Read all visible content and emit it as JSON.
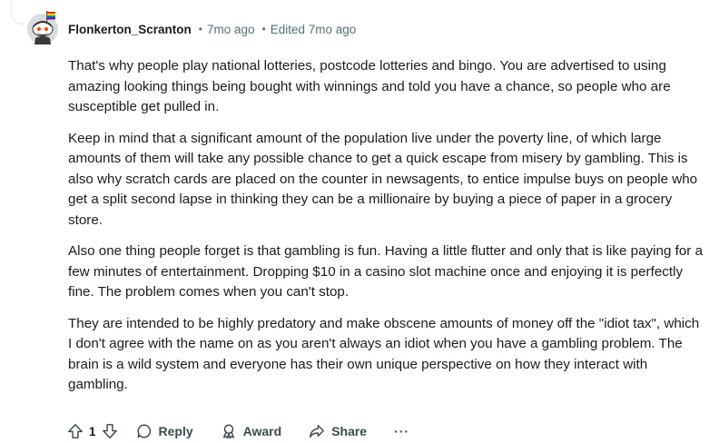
{
  "comment": {
    "username": "Flonkerton_Scranton",
    "separator": "•",
    "time": "7mo ago",
    "edited": "Edited 7mo ago",
    "paragraphs": [
      "That's why people play national lotteries, postcode lotteries and bingo. You are advertised to using amazing looking things being bought with winnings and told you have a chance, so people who are susceptible get pulled in.",
      "Keep in mind that a significant amount of the population live under the poverty line, of which large amounts of them will take any possible chance to get a quick escape from misery by gambling. This is also why scratch cards are placed on the counter in newsagents, to entice impulse buys on people who get a split second lapse in thinking they can be a millionaire by buying a piece of paper in a grocery store.",
      "Also one thing people forget is that gambling is fun. Having a little flutter and only that is like paying for a few minutes of entertainment. Dropping $10 in a casino slot machine once and enjoying it is perfectly fine. The problem comes when you can't stop.",
      "They are intended to be highly predatory and make obscene amounts of money off the \"idiot tax\", which I don't agree with the name on as you aren't always an idiot when you have a gambling problem. The brain is a wild system and everyone has their own unique perspective on how they interact with gambling."
    ]
  },
  "actions": {
    "vote_count": "1",
    "reply_label": "Reply",
    "award_label": "Award",
    "share_label": "Share",
    "more_label": "···"
  },
  "icons": {
    "avatar": "snoo-avatar-with-rainbow-flag",
    "upvote": "upvote-arrow-icon",
    "downvote": "downvote-arrow-icon",
    "reply": "speech-bubble-icon",
    "award": "award-ribbon-icon",
    "share": "share-arrow-icon",
    "more": "ellipsis-icon"
  },
  "colors": {
    "text": "#1c1c1c",
    "meta": "#576f76",
    "action": "#3c4a50",
    "thread_line": "#e5e7ea"
  }
}
